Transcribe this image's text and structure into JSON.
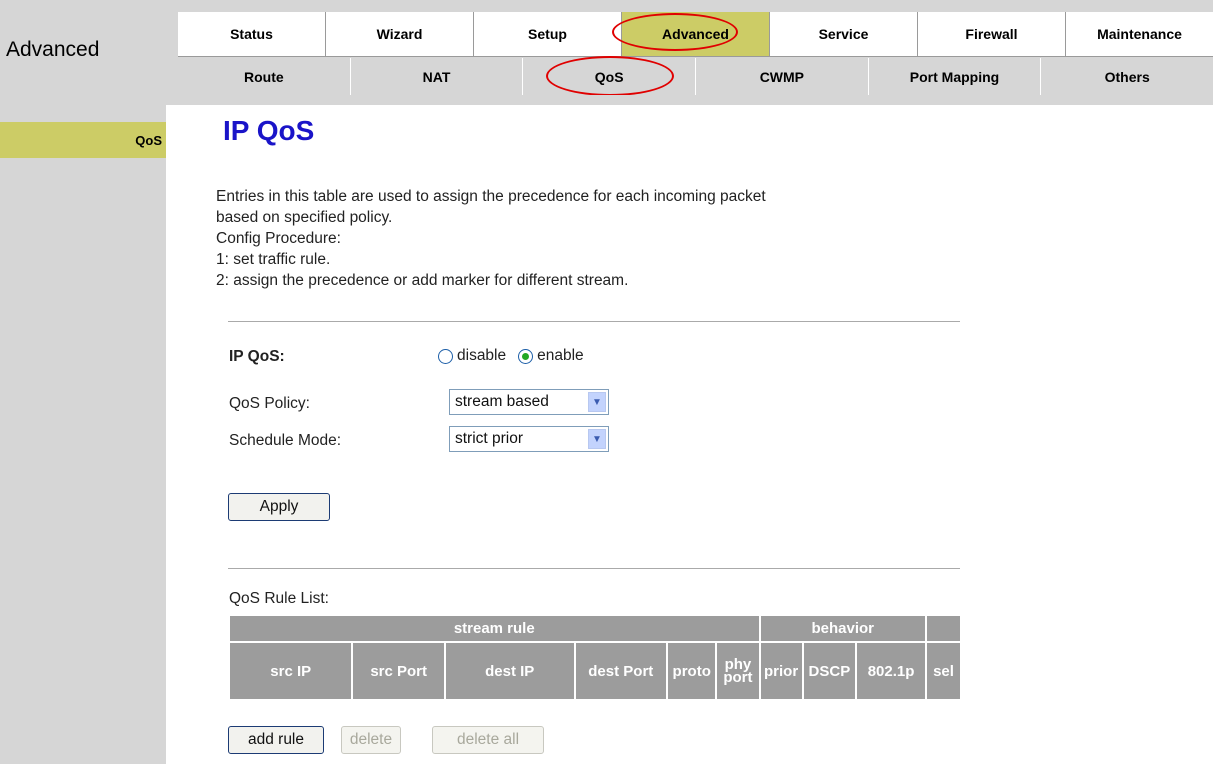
{
  "brand": "Advanced",
  "tabs": [
    {
      "label": "Status"
    },
    {
      "label": "Wizard"
    },
    {
      "label": "Setup"
    },
    {
      "label": "Advanced"
    },
    {
      "label": "Service"
    },
    {
      "label": "Firewall"
    },
    {
      "label": "Maintenance"
    }
  ],
  "subtabs": [
    {
      "label": "Route"
    },
    {
      "label": "NAT"
    },
    {
      "label": "QoS"
    },
    {
      "label": "CWMP"
    },
    {
      "label": "Port Mapping"
    },
    {
      "label": "Others"
    }
  ],
  "sidebar": {
    "items": [
      {
        "label": "QoS"
      }
    ]
  },
  "page": {
    "title": "IP QoS",
    "description": [
      "Entries in this table are used to assign the precedence for each incoming packet",
      "based on specified policy.",
      "Config Procedure:",
      "1: set traffic rule.",
      "2: assign the precedence or add marker for different stream."
    ]
  },
  "form": {
    "ipqos_label": "IP QoS:",
    "disable_label": "disable",
    "enable_label": "enable",
    "selected": "enable",
    "policy_label": "QoS Policy:",
    "policy_value": "stream based",
    "schedule_label": "Schedule Mode:",
    "schedule_value": "strict prior",
    "apply_label": "Apply"
  },
  "rules": {
    "title": "QoS Rule List:",
    "group_stream": "stream rule",
    "group_behavior": "behavior",
    "columns": [
      "src IP",
      "src Port",
      "dest IP",
      "dest Port",
      "proto",
      "phy",
      "port",
      "prior",
      "DSCP",
      "802.1p",
      "sel"
    ]
  },
  "actions": {
    "add": "add rule",
    "delete": "delete",
    "delete_all": "delete all"
  },
  "colors": {
    "accent": "#cccc66",
    "title": "#1a14c8",
    "highlight_ring": "#e00000",
    "table_header": "#9c9c9c"
  }
}
